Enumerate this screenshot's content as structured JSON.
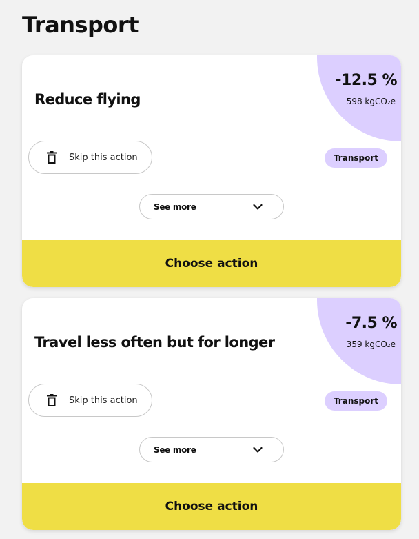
{
  "section": {
    "title": "Transport"
  },
  "actions": [
    {
      "title": "Reduce flying",
      "impact_percent": "-12.5 %",
      "impact_co2": "598 kgCO₂e",
      "skip_label": "Skip this action",
      "tag": "Transport",
      "see_more_label": "See more",
      "choose_label": "Choose action"
    },
    {
      "title": "Travel less often but for longer",
      "impact_percent": "-7.5 %",
      "impact_co2": "359 kgCO₂e",
      "skip_label": "Skip this action",
      "tag": "Transport",
      "see_more_label": "See more",
      "choose_label": "Choose action"
    }
  ],
  "colors": {
    "background": "#f2f2f2",
    "card": "#ffffff",
    "accent_purple": "#dccfff",
    "accent_yellow": "#efde45"
  },
  "icons": {
    "skip": "trash-icon",
    "see_more": "chevron-down-icon"
  }
}
